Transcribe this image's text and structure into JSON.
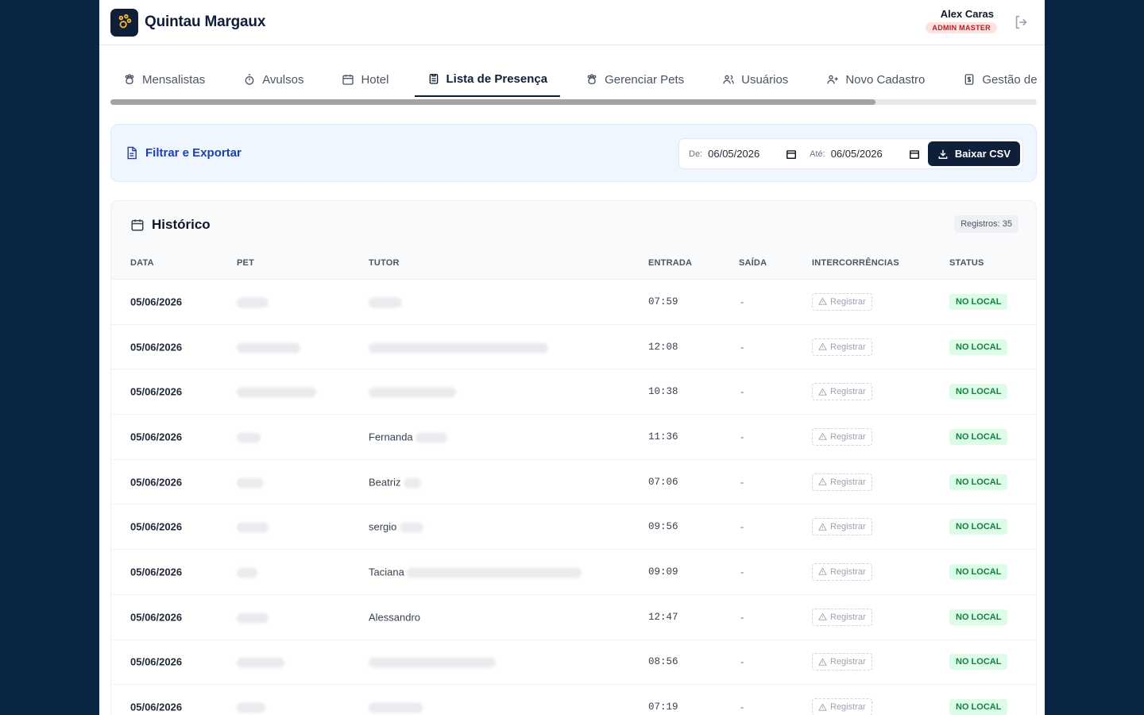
{
  "header": {
    "app_title": "Quintau Margaux",
    "user_name": "Alex Caras",
    "role": "ADMIN MASTER"
  },
  "tabs": [
    {
      "label": "Mensalistas",
      "icon": "paw-icon",
      "active": false
    },
    {
      "label": "Avulsos",
      "icon": "stopwatch-icon",
      "active": false
    },
    {
      "label": "Hotel",
      "icon": "calendar-icon",
      "active": false
    },
    {
      "label": "Lista de Presença",
      "icon": "clipboard-icon",
      "active": true
    },
    {
      "label": "Gerenciar Pets",
      "icon": "paw-icon",
      "active": false
    },
    {
      "label": "Usuários",
      "icon": "users-icon",
      "active": false
    },
    {
      "label": "Novo Cadastro",
      "icon": "user-plus-icon",
      "active": false
    },
    {
      "label": "Gestão de",
      "icon": "dollar-doc-icon",
      "active": false
    }
  ],
  "filter": {
    "title": "Filtrar e Exportar",
    "from_label": "De:",
    "from_value": "06/05/2026",
    "to_label": "Até:",
    "to_value": "06/05/2026",
    "export_label": "Baixar CSV"
  },
  "history": {
    "title": "Histórico",
    "count_label": "Registros: 35",
    "columns": [
      "DATA",
      "PET",
      "TUTOR",
      "ENTRADA",
      "SAÍDA",
      "INTERCORRÊNCIAS",
      "STATUS"
    ],
    "register_label": "Registrar",
    "rows": [
      {
        "date": "05/06/2026",
        "tutor": "",
        "entrada": "07:59",
        "saida": "-",
        "status": "NO LOCAL"
      },
      {
        "date": "05/06/2026",
        "tutor": "",
        "entrada": "12:08",
        "saida": "-",
        "status": "NO LOCAL"
      },
      {
        "date": "05/06/2026",
        "tutor": "",
        "entrada": "10:38",
        "saida": "-",
        "status": "NO LOCAL"
      },
      {
        "date": "05/06/2026",
        "tutor": "Fernanda",
        "entrada": "11:36",
        "saida": "-",
        "status": "NO LOCAL"
      },
      {
        "date": "05/06/2026",
        "tutor": "Beatriz",
        "entrada": "07:06",
        "saida": "-",
        "status": "NO LOCAL"
      },
      {
        "date": "05/06/2026",
        "tutor": "sergio",
        "entrada": "09:56",
        "saida": "-",
        "status": "NO LOCAL"
      },
      {
        "date": "05/06/2026",
        "tutor": "Taciana",
        "entrada": "09:09",
        "saida": "-",
        "status": "NO LOCAL"
      },
      {
        "date": "05/06/2026",
        "tutor": "Alessandro",
        "entrada": "12:47",
        "saida": "-",
        "status": "NO LOCAL"
      },
      {
        "date": "05/06/2026",
        "tutor": "",
        "entrada": "08:56",
        "saida": "-",
        "status": "NO LOCAL"
      },
      {
        "date": "05/06/2026",
        "tutor": "",
        "entrada": "07:19",
        "saida": "-",
        "status": "NO LOCAL"
      }
    ]
  }
}
